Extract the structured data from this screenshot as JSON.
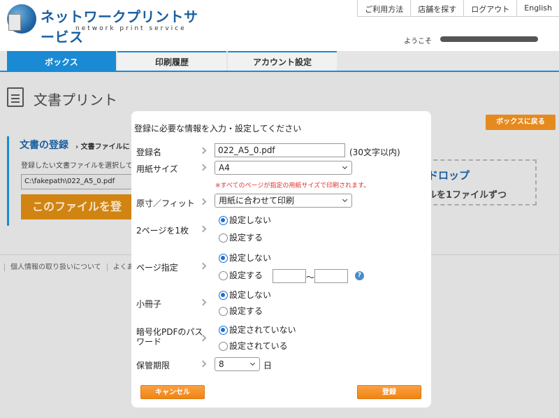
{
  "header": {
    "logo_title": "ネットワークプリントサービス",
    "logo_subtitle": "network print service",
    "links": [
      "ご利用方法",
      "店舗を探す",
      "ログアウト",
      "English"
    ],
    "welcome": "ようこそ"
  },
  "nav": {
    "tabs": [
      {
        "label": "ボックス",
        "active": true
      },
      {
        "label": "印刷履歴",
        "active": false
      },
      {
        "label": "アカウント設定",
        "active": false
      }
    ]
  },
  "page": {
    "title": "文書プリント",
    "back_button": "ボックスに戻る",
    "register_title": "文書の登録",
    "register_crumb": "› 文書ファイルに",
    "register_hint": "登録したい文書ファイルを選択して",
    "file_path": "C:\\fakepath\\022_A5_0.pdf",
    "choose_button": "このファイルを登",
    "drop_line1": "ドロップ",
    "drop_line2": "ルを1ファイルずつ",
    "footer_links": [
      "個人情報の取り扱いについて",
      "よくあ"
    ]
  },
  "modal": {
    "title": "登録に必要な情報を入力・設定してください",
    "doc_name_label": "登録名",
    "doc_name_value": "022_A5_0.pdf",
    "doc_name_hint": "(30文字以内)",
    "paper_size_label": "用紙サイズ",
    "paper_size_value": "A4",
    "paper_size_note": "※すべてのページが指定の用紙サイズで印刷されます。",
    "fit_label": "原寸／フィット",
    "fit_value": "用紙に合わせて印刷",
    "nup_label": "2ページを1枚",
    "nup_options": [
      "設定しない",
      "設定する"
    ],
    "page_range_label": "ページ指定",
    "page_range_options": [
      "設定しない",
      "設定する"
    ],
    "page_range_sep": "〜",
    "booklet_label": "小冊子",
    "booklet_options": [
      "設定しない",
      "設定する"
    ],
    "encrypt_label": "暗号化PDFのパスワード",
    "encrypt_options": [
      "設定されていない",
      "設定されている"
    ],
    "retention_label": "保管期限",
    "retention_value": "8",
    "retention_unit": "日",
    "cancel_button": "キャンセル",
    "submit_button": "登録",
    "help_icon": "?"
  }
}
